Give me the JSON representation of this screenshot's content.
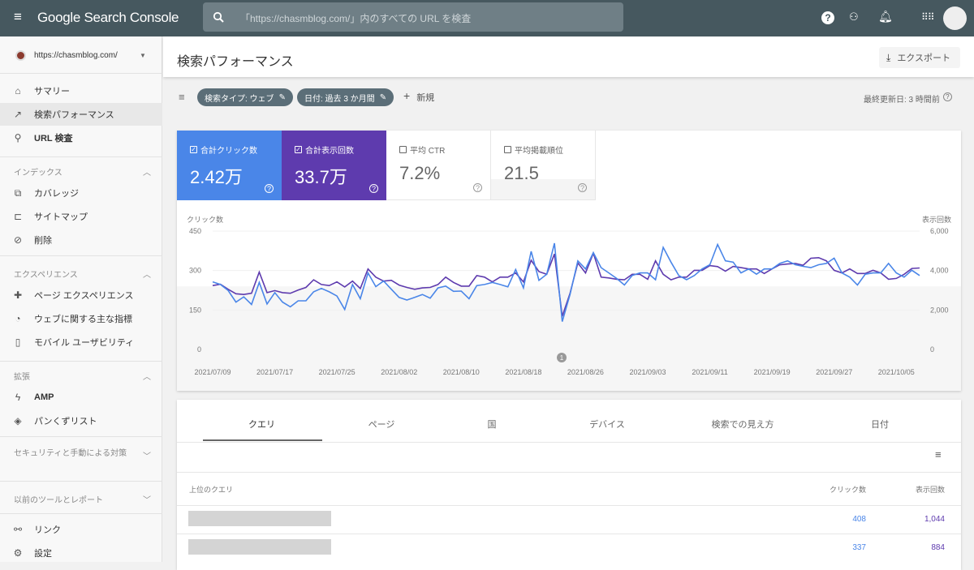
{
  "header": {
    "app_title": "Google Search Console",
    "search_placeholder": "「https://chasmblog.com/」内のすべての URL を検査"
  },
  "sidebar": {
    "property": "https://chasmblog.com/",
    "top_items": [
      {
        "label": "サマリー",
        "icon": "home-icon"
      },
      {
        "label": "検索パフォーマンス",
        "icon": "trending-up-icon",
        "active": true
      },
      {
        "label": "URL 検査",
        "icon": "search-icon"
      }
    ],
    "sections": [
      {
        "title": "インデックス",
        "items": [
          "カバレッジ",
          "サイトマップ",
          "削除"
        ]
      },
      {
        "title": "エクスペリエンス",
        "items": [
          "ページ エクスペリエンス",
          "ウェブに関する主な指標",
          "モバイル ユーザビリティ"
        ]
      },
      {
        "title": "拡張",
        "items": [
          "AMP",
          "パンくずリスト"
        ]
      },
      {
        "title": "セキュリティと手動による対策",
        "items": []
      },
      {
        "title": "以前のツールとレポート",
        "items": []
      }
    ],
    "bottom_items": [
      "リンク",
      "設定"
    ]
  },
  "page": {
    "title": "検索パフォーマンス",
    "export": "エクスポート",
    "filters": [
      "検索タイプ: ウェブ",
      "日付: 過去 3 か月間"
    ],
    "new_filter": "新規",
    "last_updated": "最終更新日: 3 時間前"
  },
  "metrics": [
    {
      "label": "合計クリック数",
      "value": "2.42万",
      "checked": true,
      "color": "#4a86e8"
    },
    {
      "label": "合計表示回数",
      "value": "33.7万",
      "checked": true,
      "color": "#5e3bae"
    },
    {
      "label": "平均 CTR",
      "value": "7.2%",
      "checked": false
    },
    {
      "label": "平均掲載順位",
      "value": "21.5",
      "checked": false
    }
  ],
  "chart_data": {
    "type": "line",
    "ylabel_left": "クリック数",
    "ylabel_right": "表示回数",
    "yticks_left": [
      "450",
      "300",
      "150",
      "0"
    ],
    "yticks_right": [
      "6,000",
      "4,000",
      "2,000",
      "0"
    ],
    "ylim_left": [
      0,
      450
    ],
    "ylim_right": [
      0,
      6000
    ],
    "start_date": "2021/07/09",
    "xtick_labels": [
      "2021/07/09",
      "2021/07/17",
      "2021/07/25",
      "2021/08/02",
      "2021/08/10",
      "2021/08/18",
      "2021/08/26",
      "2021/09/03",
      "2021/09/11",
      "2021/09/19",
      "2021/09/27",
      "2021/10/05"
    ],
    "annotation": "1",
    "series": [
      {
        "name": "クリック数",
        "color": "#4a86e8",
        "values": [
          257,
          247,
          224,
          180,
          200,
          171,
          255,
          173,
          216,
          180,
          162,
          185,
          185,
          219,
          232,
          219,
          203,
          152,
          247,
          193,
          291,
          239,
          260,
          229,
          198,
          188,
          198,
          209,
          195,
          234,
          241,
          221,
          222,
          193,
          243,
          247,
          255,
          247,
          238,
          304,
          234,
          373,
          263,
          286,
          404,
          106,
          209,
          337,
          306,
          368,
          311,
          291,
          270,
          245,
          281,
          291,
          291,
          265,
          388,
          332,
          281,
          265,
          281,
          306,
          322,
          399,
          337,
          332,
          291,
          306,
          286,
          306,
          306,
          327,
          337,
          322,
          316,
          311,
          322,
          327,
          347,
          291,
          275,
          245,
          286,
          291,
          291,
          327,
          291,
          275,
          301,
          281
        ]
      },
      {
        "name": "表示回数",
        "color": "#5e3bae",
        "values": [
          3240,
          3305,
          3050,
          2825,
          2785,
          2850,
          3920,
          2880,
          2985,
          2880,
          2850,
          3010,
          3145,
          3530,
          3290,
          3240,
          3425,
          3170,
          3465,
          3090,
          4080,
          3665,
          3465,
          3505,
          3265,
          3145,
          3050,
          3120,
          3145,
          3290,
          3665,
          3400,
          3210,
          3210,
          3745,
          3665,
          3425,
          3665,
          3665,
          3880,
          3425,
          4520,
          3945,
          3810,
          4840,
          1680,
          2850,
          4385,
          3880,
          4880,
          3665,
          3625,
          3560,
          3530,
          3810,
          3810,
          3560,
          4490,
          3810,
          3530,
          3665,
          3665,
          4010,
          4010,
          4250,
          4200,
          3970,
          4210,
          4145,
          4080,
          4080,
          3850,
          4080,
          4290,
          4330,
          4360,
          4265,
          4625,
          4650,
          4490,
          4010,
          3880,
          4080,
          3850,
          3850,
          4010,
          3880,
          3560,
          3600,
          3810,
          4105,
          4130
        ]
      }
    ]
  },
  "table": {
    "tabs": [
      "クエリ",
      "ページ",
      "国",
      "デバイス",
      "検索での見え方",
      "日付"
    ],
    "columns": [
      "上位のクエリ",
      "クリック数",
      "表示回数"
    ],
    "rows": [
      {
        "clicks": "408",
        "impressions": "1,044"
      },
      {
        "clicks": "337",
        "impressions": "884"
      }
    ]
  }
}
